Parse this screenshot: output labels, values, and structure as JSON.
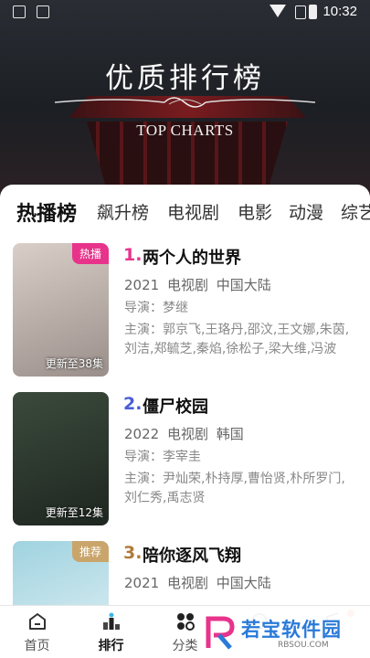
{
  "status_bar": {
    "time": "10:32"
  },
  "header": {
    "title": "优质排行榜",
    "subtitle": "TOP CHARTS"
  },
  "tabs": [
    {
      "label": "热播榜",
      "active": true
    },
    {
      "label": "飙升榜"
    },
    {
      "label": "电视剧"
    },
    {
      "label": "电影"
    },
    {
      "label": "动漫"
    },
    {
      "label": "综艺"
    }
  ],
  "items": [
    {
      "rank": "1.",
      "rank_color": "#e8338b",
      "title": "两个人的世界",
      "year": "2021",
      "type": "电视剧",
      "region": "中国大陆",
      "director": "导演：梦继",
      "cast": "主演：郭京飞,王珞丹,邵汶,王文娜,朱茵,刘洁,郑毓芝,秦焰,徐松子,梁大维,冯波",
      "badge": "热播",
      "badge_color": "#e8338b",
      "update": "更新至38集",
      "poster_colors": [
        "#d9cfc8",
        "#9a8f8a"
      ]
    },
    {
      "rank": "2.",
      "rank_color": "#4a5fd8",
      "title": "僵尸校园",
      "year": "2022",
      "type": "电视剧",
      "region": "韩国",
      "director": "导演：李宰圭",
      "cast": "主演：尹灿荣,朴持厚,曹怡贤,朴所罗门,刘仁秀,禹志贤",
      "badge": "",
      "update": "更新至12集",
      "poster_colors": [
        "#3b4a3c",
        "#1e2620"
      ]
    },
    {
      "rank": "3.",
      "rank_color": "#b07a3a",
      "title": "陪你逐风飞翔",
      "year": "2021",
      "type": "电视剧",
      "region": "中国大陆",
      "badge": "推荐",
      "badge_color": "#c9a56b",
      "poster_colors": [
        "#9fd3e0",
        "#e9f3f5"
      ]
    }
  ],
  "bottom_nav": [
    {
      "label": "首页",
      "icon": "home-icon"
    },
    {
      "label": "排行",
      "icon": "ranking-icon",
      "active": true
    },
    {
      "label": "分类",
      "icon": "category-icon"
    },
    {
      "label": "",
      "icon": "discover-icon"
    },
    {
      "label": "",
      "icon": "profile-icon"
    }
  ],
  "watermark": {
    "text": "若宝软件园",
    "sub": "RBSOU.COM"
  }
}
